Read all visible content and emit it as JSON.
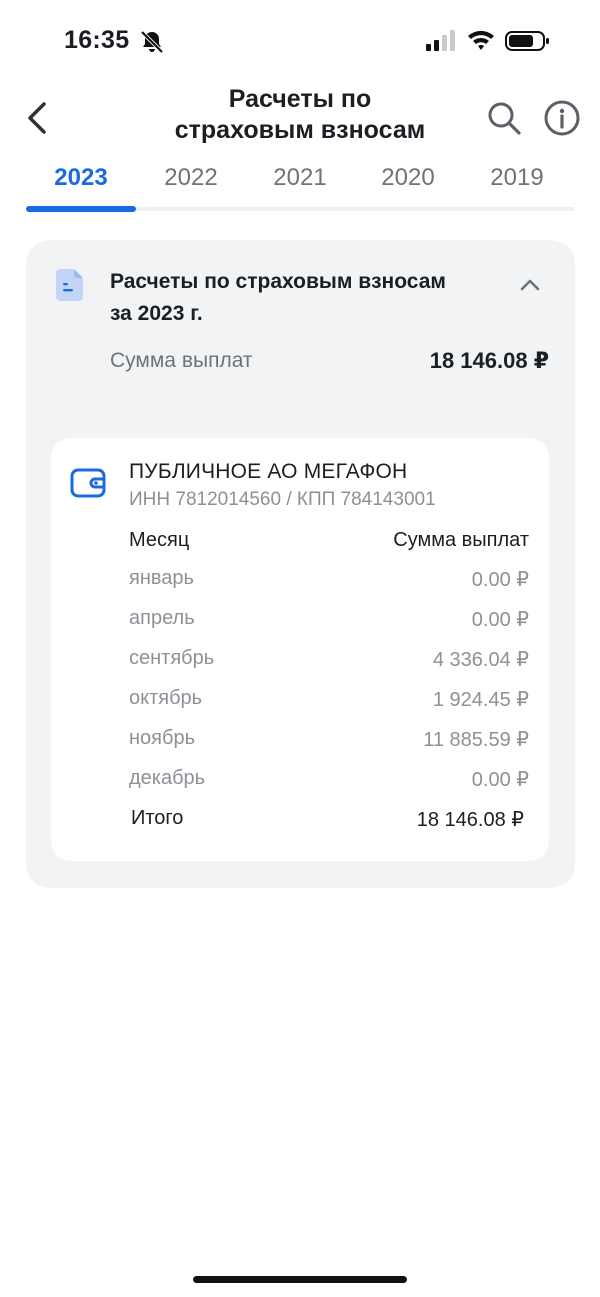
{
  "status_bar": {
    "time": "16:35"
  },
  "header": {
    "title_line1": "Расчеты по",
    "title_line2": "страховым взносам"
  },
  "tabs": [
    {
      "label": "2023"
    },
    {
      "label": "2022"
    },
    {
      "label": "2021"
    },
    {
      "label": "2020"
    },
    {
      "label": "2019"
    }
  ],
  "summary": {
    "title_line1": "Расчеты по страховым взносам",
    "title_line2": "за 2023 г.",
    "sum_label": "Сумма выплат",
    "sum_value": "18 146.08 ₽"
  },
  "employer": {
    "name": "ПУБЛИЧНОЕ АО МЕГАФОН",
    "ids": "ИНН 7812014560 / КПП 784143001",
    "col_month": "Месяц",
    "col_sum": "Сумма выплат",
    "rows": [
      {
        "month": "январь",
        "value": "0.00 ₽"
      },
      {
        "month": "апрель",
        "value": "0.00 ₽"
      },
      {
        "month": "сентябрь",
        "value": "4 336.04 ₽"
      },
      {
        "month": "октябрь",
        "value": "1 924.45 ₽"
      },
      {
        "month": "ноябрь",
        "value": "11 885.59 ₽"
      },
      {
        "month": "декабрь",
        "value": "0.00 ₽"
      }
    ],
    "total_label": "Итого",
    "total_value": "18 146.08 ₽"
  },
  "colors": {
    "accent": "#1a6be0",
    "card_bg": "#f2f3f5",
    "muted_text": "#8d9197"
  }
}
